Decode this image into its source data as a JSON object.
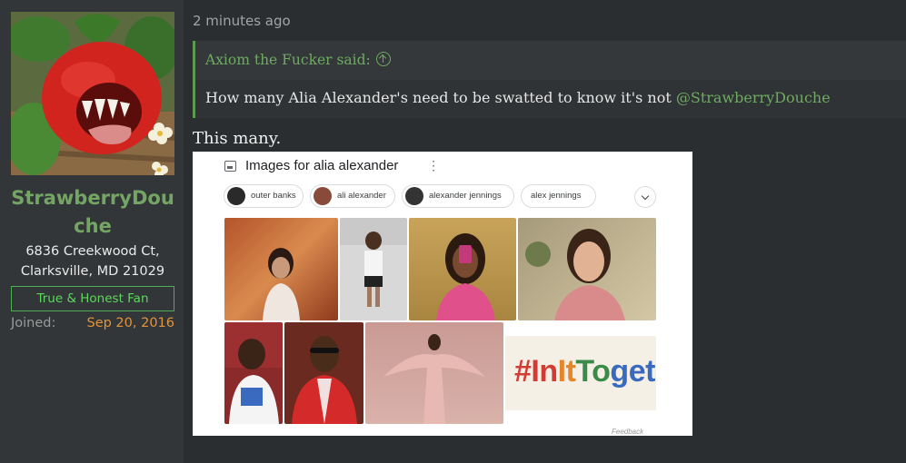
{
  "user": {
    "username": "StrawberryDouche",
    "address_line1": "6836 Creekwood Ct,",
    "address_line2": "Clarksville, MD 21029",
    "banner": "True & Honest Fan",
    "joined_label": "Joined:",
    "joined_date": "Sep 20, 2016"
  },
  "post": {
    "timestamp": "2 minutes ago",
    "quote": {
      "author": "Axiom the Fucker said:",
      "text": "How many Alia Alexander's need to be swatted to know it's not ",
      "mention": "@StrawberryDouche"
    },
    "body": "This many."
  },
  "image": {
    "title": "Images for alia alexander",
    "menu_glyph": "⋮",
    "chips": [
      "outer banks",
      "ali alexander",
      "alexander jennings",
      "alex jennings"
    ],
    "hashtag": "#InItToget",
    "feedback": "Feedback"
  },
  "colors": {
    "accent_green": "#74a565",
    "banner_green": "#5fd65f",
    "joined_orange": "#e2943a"
  }
}
